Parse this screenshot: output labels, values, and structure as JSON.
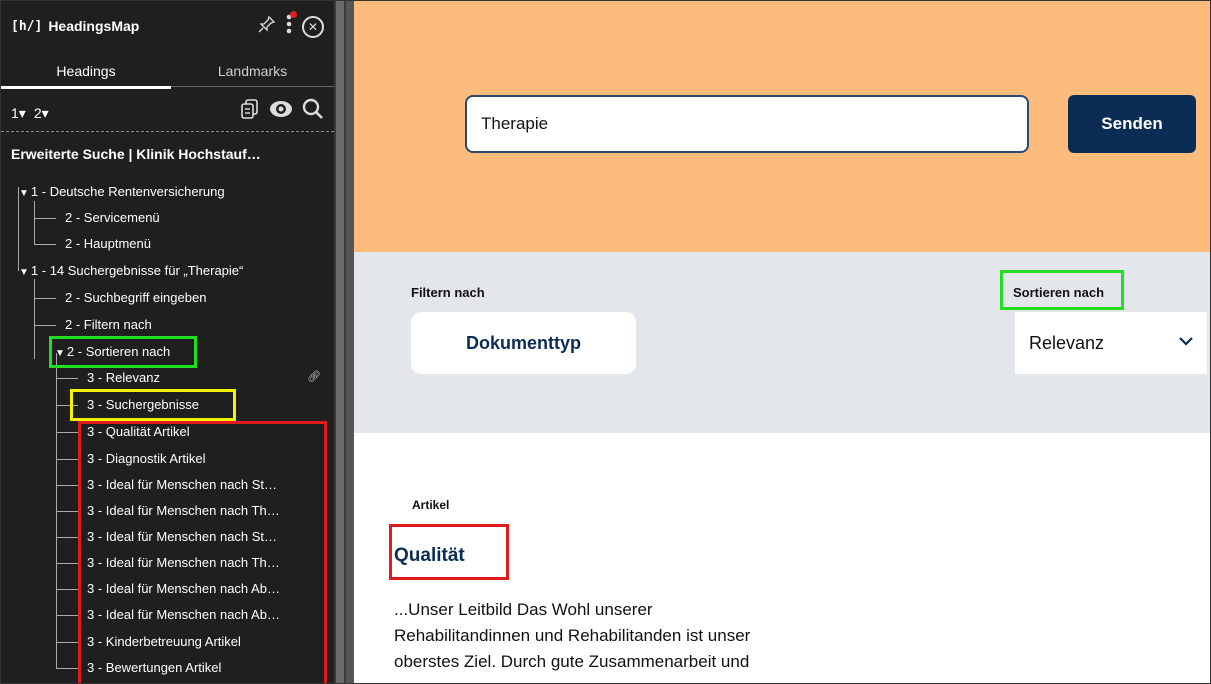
{
  "headingsmap": {
    "logo_mark": "[h/]",
    "title": "HeadingsMap",
    "icons": [
      "pin-icon",
      "kebab-menu-icon",
      "close-icon"
    ],
    "tabs": [
      {
        "label": "Headings",
        "active": true
      },
      {
        "label": "Landmarks",
        "active": false
      }
    ],
    "levels": [
      "1▾",
      "2▾"
    ],
    "control_icons": [
      "copy-icon",
      "eye-icon",
      "search-icon"
    ],
    "page_title": "Erweiterte Suche | Klinik Hochstauf…",
    "tree": [
      {
        "label": "1 - Deutsche Rentenversicherung"
      },
      {
        "label": "2 - Servicemenü"
      },
      {
        "label": "2 - Hauptmenü"
      },
      {
        "label": "1 - 14 Suchergebnisse für „Therapie“"
      },
      {
        "label": "2 - Suchbegriff eingeben"
      },
      {
        "label": "2 - Filtern nach"
      },
      {
        "label": "2 - Sortieren nach"
      },
      {
        "label": "3 - Relevanz"
      },
      {
        "label": "3 - Suchergebnisse"
      },
      {
        "label": "3 - Qualität Artikel"
      },
      {
        "label": "3 - Diagnostik Artikel"
      },
      {
        "label": "3 - Ideal für Menschen nach St…"
      },
      {
        "label": "3 - Ideal für Menschen nach Th…"
      },
      {
        "label": "3 - Ideal für Menschen nach St…"
      },
      {
        "label": "3 - Ideal für Menschen nach Th…"
      },
      {
        "label": "3 - Ideal für Menschen nach Ab…"
      },
      {
        "label": "3 - Ideal für Menschen nach Ab…"
      },
      {
        "label": "3 - Kinderbetreuung Artikel"
      },
      {
        "label": "3 - Bewertungen Artikel"
      }
    ]
  },
  "page": {
    "search": {
      "value": "Therapie",
      "button": "Senden"
    },
    "filter": {
      "label": "Filtern nach",
      "button": "Dokumenttyp"
    },
    "sort": {
      "label": "Sortieren nach",
      "selected": "Relevanz"
    },
    "result": {
      "kicker": "Artikel",
      "title": "Qualität",
      "excerpt_lines": [
        "...Unser Leitbild Das Wohl unserer",
        "Rehabilitandinnen und Rehabilitanden ist unser",
        "oberstes Ziel. Durch gute Zusammenarbeit und"
      ]
    }
  },
  "colors": {
    "highlight_green": "#22dd22",
    "highlight_yellow": "#f4f400",
    "highlight_red": "#e01b1b",
    "header_orange": "#fdbc7c",
    "brand_navy": "#0b2c54",
    "filter_gray": "#e3e6ea"
  }
}
